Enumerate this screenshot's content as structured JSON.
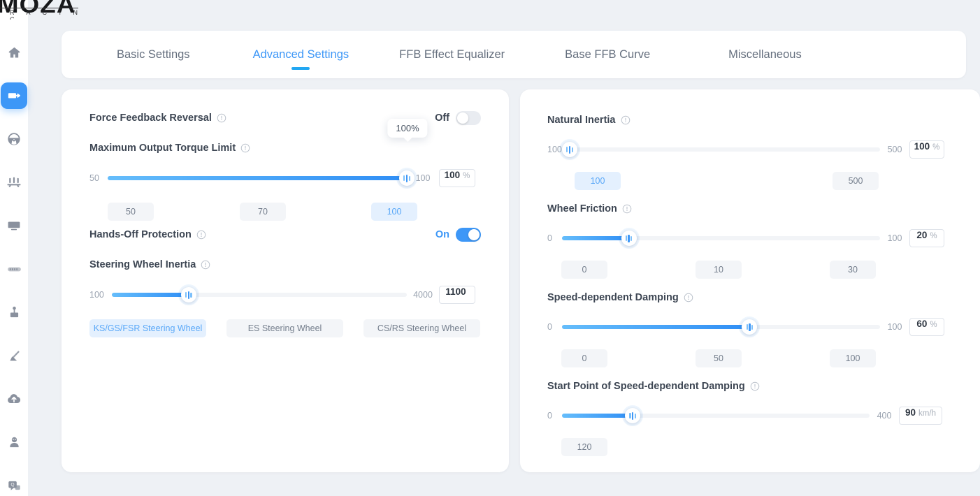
{
  "brand": {
    "name": "MOZA",
    "sub": "R A C I N G"
  },
  "sidebar": {
    "items": [
      {
        "name": "home-icon",
        "label": "Home",
        "active": false
      },
      {
        "name": "wheelbase-icon",
        "label": "Wheelbase",
        "active": true
      },
      {
        "name": "steering-wheel-icon",
        "label": "Steering Wheel",
        "active": false
      },
      {
        "name": "pedals-icon",
        "label": "Pedals",
        "active": false
      },
      {
        "name": "dash-display-icon",
        "label": "Dash Display",
        "active": false
      },
      {
        "name": "button-box-icon",
        "label": "Button Box",
        "active": false
      },
      {
        "name": "shifter-icon",
        "label": "Shifter",
        "active": false
      },
      {
        "name": "handbrake-icon",
        "label": "Handbrake",
        "active": false
      },
      {
        "name": "cloud-upload-icon",
        "label": "Cloud",
        "active": false
      },
      {
        "name": "user-profile-icon",
        "label": "Profile",
        "active": false
      },
      {
        "name": "faq-icon",
        "label": "FAQ",
        "active": false
      }
    ]
  },
  "tabs": [
    {
      "label": "Basic Settings",
      "active": false
    },
    {
      "label": "Advanced Settings",
      "active": true
    },
    {
      "label": "FFB Effect Equalizer",
      "active": false
    },
    {
      "label": "Base FFB Curve",
      "active": false
    },
    {
      "label": "Miscellaneous",
      "active": false
    }
  ],
  "left_panel": {
    "force_feedback_reversal": {
      "title": "Force Feedback Reversal",
      "state_label": "Off",
      "on": false
    },
    "maximum_output_torque_limit": {
      "title": "Maximum Output Torque Limit",
      "min_label": "50",
      "max_label": "100",
      "value": "100",
      "unit": "%",
      "tooltip": "100%",
      "fill_percent": 100,
      "presets": [
        "50",
        "70",
        "100"
      ],
      "selected_preset": 2
    },
    "hands_off_protection": {
      "title": "Hands-Off Protection",
      "state_label": "On",
      "on": true
    },
    "steering_wheel_inertia": {
      "title": "Steering Wheel Inertia",
      "min_label": "100",
      "max_label": "4000",
      "value": "1100",
      "unit": "",
      "fill_percent": 26,
      "presets": [
        "KS/GS/FSR Steering Wheel",
        "ES Steering Wheel",
        "CS/RS Steering Wheel"
      ],
      "selected_preset": 0
    }
  },
  "right_panel": {
    "natural_inertia": {
      "title": "Natural Inertia",
      "min_label": "100",
      "max_label": "500",
      "value": "100",
      "unit": "%",
      "fill_percent": 0,
      "presets": [
        "100",
        "500"
      ],
      "selected_preset": 0
    },
    "wheel_friction": {
      "title": "Wheel Friction",
      "min_label": "0",
      "max_label": "100",
      "value": "20",
      "unit": "%",
      "fill_percent": 21,
      "presets": [
        "0",
        "10",
        "30"
      ],
      "selected_preset": -1
    },
    "speed_dependent_damping": {
      "title": "Speed-dependent Damping",
      "min_label": "0",
      "max_label": "100",
      "value": "60",
      "unit": "%",
      "fill_percent": 59,
      "presets": [
        "0",
        "50",
        "100"
      ],
      "selected_preset": -1
    },
    "start_point_damping": {
      "title": "Start Point of Speed-dependent Damping",
      "min_label": "0",
      "max_label": "400",
      "value": "90",
      "unit": "km/h",
      "fill_percent": 23,
      "presets": [
        "120"
      ],
      "selected_preset": -1
    }
  },
  "colors": {
    "accent": "#3d97f7",
    "tab_underline": "#22a7f2",
    "page_bg": "#eef1f5",
    "card_bg": "#ffffff",
    "title_text": "#3d4653",
    "muted_text": "#9aa3b0"
  }
}
